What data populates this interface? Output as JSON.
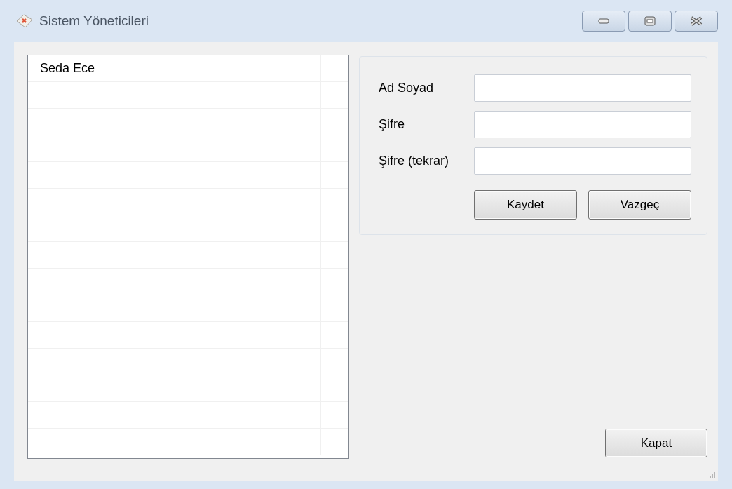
{
  "window": {
    "title": "Sistem Yöneticileri"
  },
  "list": {
    "rows": [
      {
        "name": "Seda Ece"
      }
    ]
  },
  "form": {
    "fields": [
      {
        "label": "Ad Soyad"
      },
      {
        "label": "Şifre"
      },
      {
        "label": "Şifre (tekrar)"
      }
    ],
    "buttons": [
      "Kaydet",
      "Vazgeç"
    ]
  },
  "close_button": "Kapat"
}
